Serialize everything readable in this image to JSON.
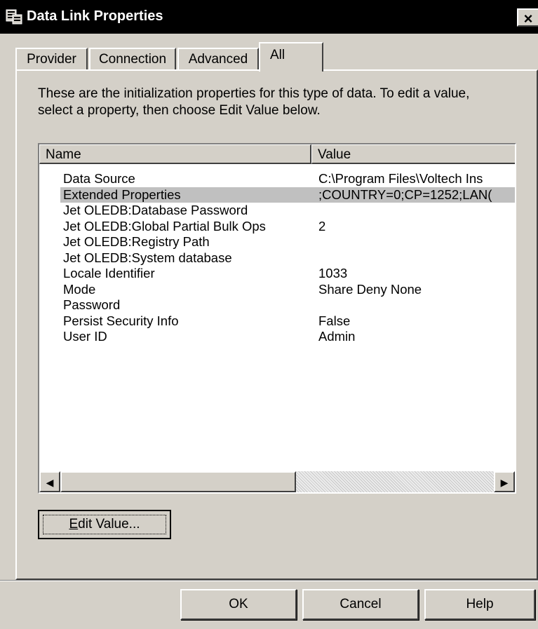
{
  "window": {
    "title": "Data Link Properties",
    "close_label": "×"
  },
  "tabs": [
    {
      "label": "Provider",
      "active": false
    },
    {
      "label": "Connection",
      "active": false
    },
    {
      "label": "Advanced",
      "active": false
    },
    {
      "label": "All",
      "active": true
    }
  ],
  "description": "These are the initialization properties for this type of data. To edit a value, select a property, then choose Edit Value below.",
  "properties_list": {
    "columns": [
      "Name",
      "Value"
    ],
    "rows": [
      {
        "name": "Data Source",
        "value": "C:\\Program Files\\Voltech Ins"
      },
      {
        "name": "Extended Properties",
        "value": ";COUNTRY=0;CP=1252;LAN("
      },
      {
        "name": "Jet OLEDB:Database Password",
        "value": ""
      },
      {
        "name": "Jet OLEDB:Global Partial Bulk Ops",
        "value": "2"
      },
      {
        "name": "Jet OLEDB:Registry Path",
        "value": ""
      },
      {
        "name": "Jet OLEDB:System database",
        "value": ""
      },
      {
        "name": "Locale Identifier",
        "value": "1033"
      },
      {
        "name": "Mode",
        "value": "Share Deny None"
      },
      {
        "name": "Password",
        "value": ""
      },
      {
        "name": "Persist Security Info",
        "value": "False"
      },
      {
        "name": "User ID",
        "value": "Admin"
      }
    ],
    "selected_row": "Extended Properties",
    "scroll_left_icon": "◀",
    "scroll_right_icon": "▶"
  },
  "buttons": {
    "edit_value_mnemonic": "E",
    "edit_value_rest": "dit Value...",
    "ok": "OK",
    "cancel": "Cancel",
    "help": "Help"
  },
  "icons": {
    "title_icon": "data-link-icon"
  }
}
